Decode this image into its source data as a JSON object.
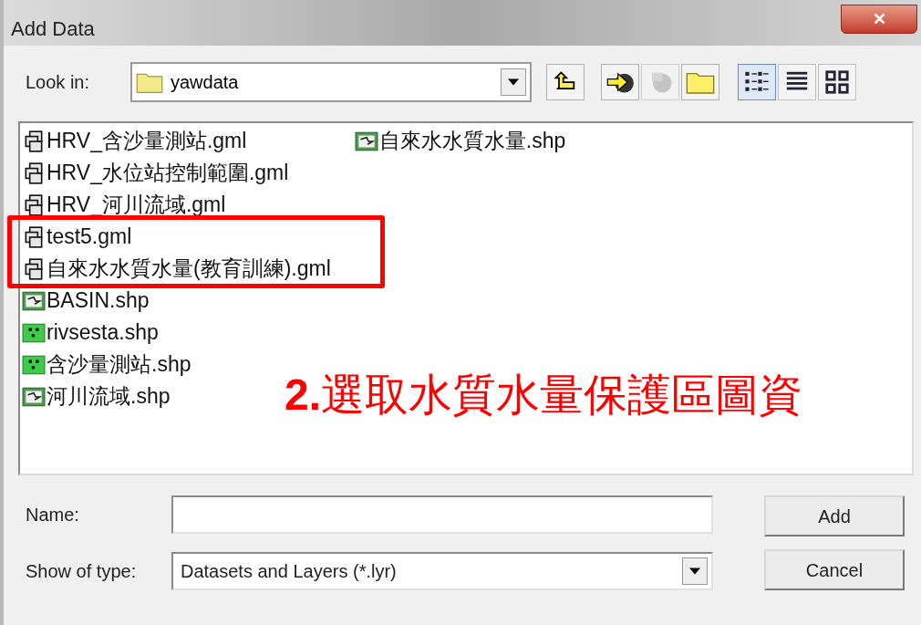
{
  "window": {
    "title": "Add Data",
    "close": "✕"
  },
  "look_in": {
    "label": "Look in:",
    "value": "yawdata"
  },
  "toolbar": [
    {
      "kind": "up",
      "disabled": false
    },
    {
      "kind": "connect",
      "disabled": false
    },
    {
      "kind": "disconnect",
      "disabled": true
    },
    {
      "kind": "newfolder",
      "disabled": false
    }
  ],
  "views": [
    {
      "kind": "list",
      "selected": true
    },
    {
      "kind": "details",
      "selected": false
    },
    {
      "kind": "thumbnails",
      "selected": false
    }
  ],
  "files": [
    {
      "name": "HRV_含沙量測站.gml",
      "kind": "layer",
      "highlighted": false
    },
    {
      "name": "HRV_水位站控制範圍.gml",
      "kind": "layer",
      "highlighted": false
    },
    {
      "name": "HRV_河川流域.gml",
      "kind": "layer",
      "highlighted": false
    },
    {
      "name": "test5.gml",
      "kind": "layer",
      "highlighted": true
    },
    {
      "name": "自來水水質水量(教育訓練).gml",
      "kind": "layer",
      "highlighted": true
    },
    {
      "name": "BASIN.shp",
      "kind": "polygon",
      "highlighted": false
    },
    {
      "name": "rivsesta.shp",
      "kind": "point",
      "highlighted": false
    },
    {
      "name": "含沙量測站.shp",
      "kind": "point",
      "highlighted": false
    },
    {
      "name": "河川流域.shp",
      "kind": "polygon",
      "highlighted": false
    },
    {
      "name": "自來水水質水量.shp",
      "kind": "polygon",
      "highlighted": false
    }
  ],
  "annotation": "**2.**選取水質水量保護區圖資",
  "name_field": {
    "label": "Name:"
  },
  "type_field": {
    "label": "Show of type:",
    "value": "Datasets and Layers (*.lyr)"
  },
  "buttons": [
    "Add",
    "Cancel"
  ]
}
